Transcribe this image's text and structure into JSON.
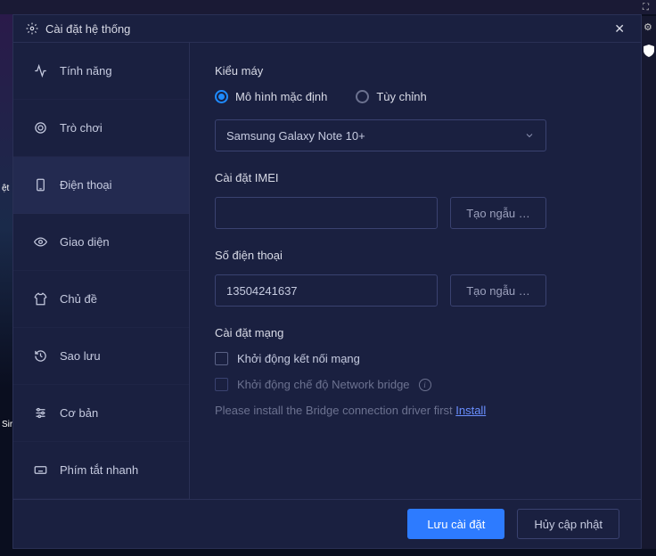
{
  "titlebar": {
    "title": "Cài đặt hệ thống"
  },
  "sidebar": {
    "items": [
      {
        "label": "Tính năng"
      },
      {
        "label": "Trò chơi"
      },
      {
        "label": "Điện thoại"
      },
      {
        "label": "Giao diện"
      },
      {
        "label": "Chủ đề"
      },
      {
        "label": "Sao lưu"
      },
      {
        "label": "Cơ bản"
      },
      {
        "label": "Phím tắt nhanh"
      }
    ]
  },
  "content": {
    "model": {
      "label": "Kiểu máy",
      "radio_default": "Mô hình mặc định",
      "radio_custom": "Tùy chỉnh",
      "selected": "Samsung Galaxy Note 10+"
    },
    "imei": {
      "label": "Cài đặt IMEI",
      "value": "",
      "random_btn": "Tạo ngẫu …"
    },
    "phone": {
      "label": "Số điện thoại",
      "value": "13504241637",
      "random_btn": "Tạo ngẫu …"
    },
    "network": {
      "label": "Cài đặt mạng",
      "cb1": "Khởi động kết nối mạng",
      "cb2": "Khởi động chế độ Network bridge",
      "hint_pre": "Please install the Bridge connection driver first ",
      "hint_link": "Install"
    }
  },
  "footer": {
    "save": "Lưu cài đặt",
    "cancel": "Hủy cập nhật"
  }
}
